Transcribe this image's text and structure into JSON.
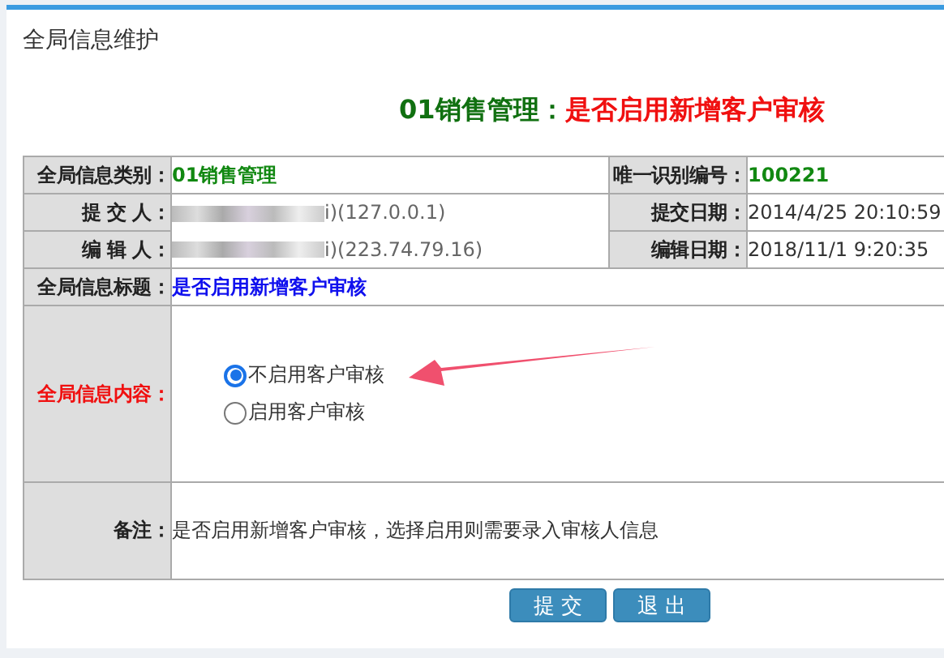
{
  "page_title": "全局信息维护",
  "heading": {
    "category": "01销售管理",
    "separator": "：",
    "title": "是否启用新增客户审核"
  },
  "category": {
    "label": "全局信息类别：",
    "value": "01销售管理"
  },
  "unique_id": {
    "label": "唯一识别编号：",
    "value": "100221"
  },
  "submitter": {
    "label": "提 交 人：",
    "value": "i)(127.0.0.1)"
  },
  "submit_date": {
    "label": "提交日期：",
    "value": "2014/4/25 20:10:59"
  },
  "editor": {
    "label": "编 辑 人：",
    "value": "i)(223.74.79.16)"
  },
  "edit_date": {
    "label": "编辑日期：",
    "value": "2018/11/1 9:20:35"
  },
  "info_title": {
    "label": "全局信息标题：",
    "value": "是否启用新增客户审核"
  },
  "content": {
    "label": "全局信息内容：",
    "options": [
      {
        "label": "不启用客户审核",
        "selected": true
      },
      {
        "label": "启用客户审核",
        "selected": false
      }
    ]
  },
  "remark": {
    "label": "备注：",
    "value": "是否启用新增客户审核，选择启用则需要录入审核人信息"
  },
  "buttons": [
    {
      "label": "提 交"
    },
    {
      "label": "退 出"
    }
  ]
}
